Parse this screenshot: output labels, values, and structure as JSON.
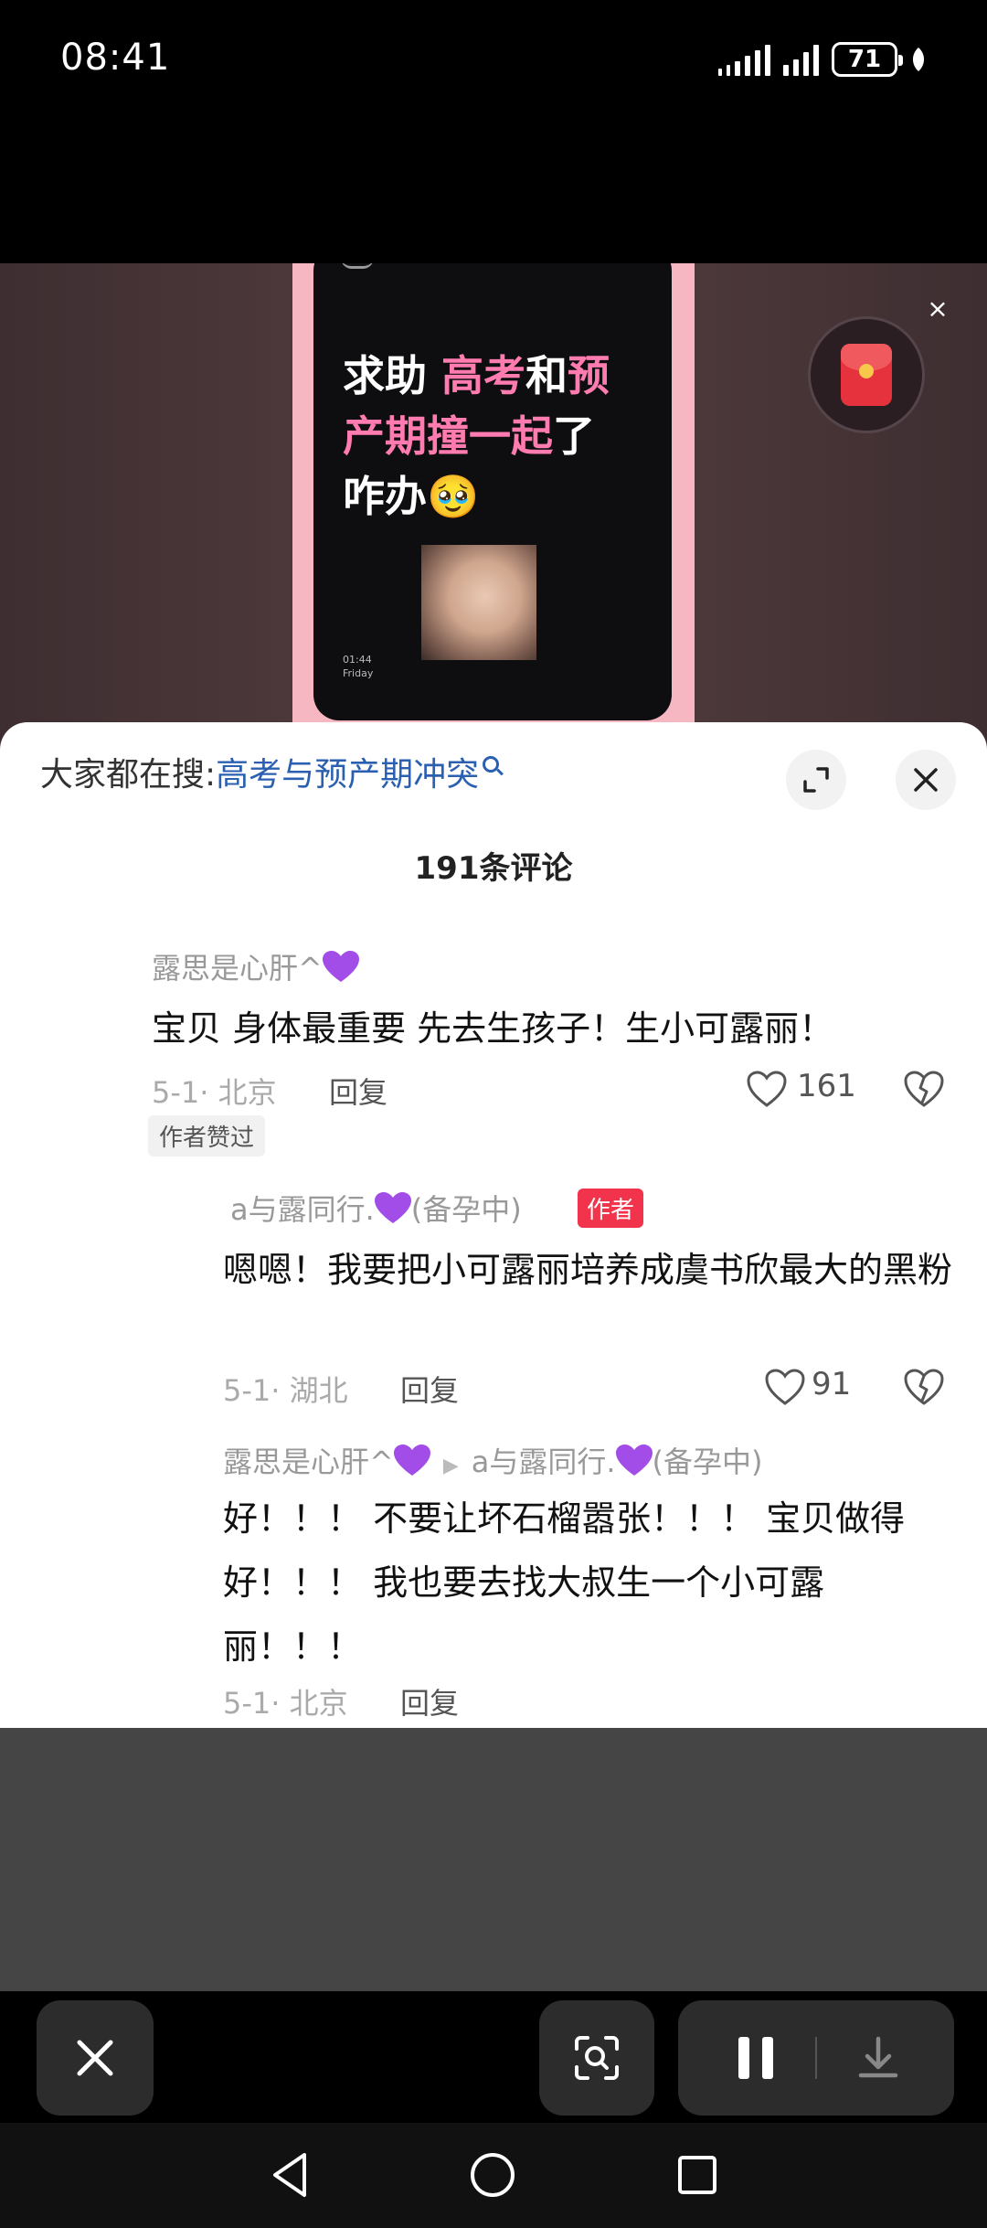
{
  "status_bar": {
    "time": "08:41",
    "battery": "71"
  },
  "video": {
    "text_line1_white": "求助 ",
    "text_line1_pink": "高考",
    "text_line1_white2": "和",
    "text_line1_pink2": "预",
    "text_line2_pink": "产期撞一起",
    "text_line2_white": "了",
    "text_line3": "咋办🥹",
    "phone_time": "01:44",
    "phone_day": "Friday",
    "close_icon": "×"
  },
  "search": {
    "prefix": "大家都在搜:",
    "query": "高考与预产期冲突"
  },
  "comments_count": "191条评论",
  "comments": [
    {
      "name": "露思是心肝^",
      "body": "宝贝 身体最重要 先去生孩子！生小可露丽！",
      "date_loc": "5-1· 北京",
      "reply": "回复",
      "likes": "161",
      "tag": "作者赞过"
    },
    {
      "name": "a与露同行.",
      "name_suffix": "(备孕中)",
      "author_tag": "作者",
      "body": "嗯嗯！我要把小可露丽培养成虞书欣最大的黑粉",
      "date_loc": "5-1· 湖北",
      "reply": "回复",
      "likes": "91"
    },
    {
      "name": "露思是心肝^",
      "reply_to": "a与露同行.",
      "reply_to_suffix": "(备孕中)",
      "body": "好！！！ 不要让坏石榴嚣张！！！ 宝贝做得好！！！ 我也要去找大叔生一个小可露丽！！！",
      "date_loc": "5-1· 北京",
      "reply": "回复"
    }
  ],
  "colors": {
    "accent_pink": "#ff7bb0",
    "search_blue": "#2b5fb0",
    "author_red": "#f1344b",
    "heart_purple": "#a24de8"
  }
}
